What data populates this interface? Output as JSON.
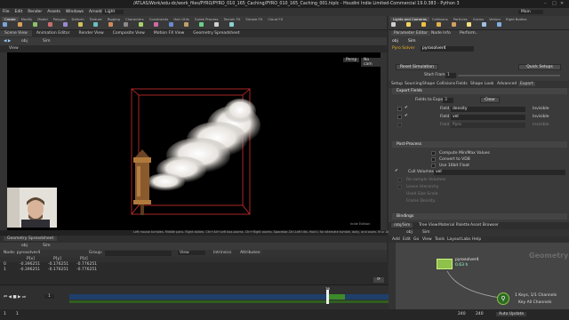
{
  "window": {
    "title": "/ATLAS/Work/edu-dc/work_files/PYRO/PYRO_010_165_Caching/PYRO_010_165_Caching_001.hiplc - Houdini Indie Limited-Commercial 19.0.383 - Python 3"
  },
  "menubar": {
    "items": [
      "File",
      "Edit",
      "Render",
      "Assets",
      "Windows",
      "Arnold",
      "Help"
    ],
    "desktop": "Light",
    "build": "Main"
  },
  "shelf_left": {
    "tabs": [
      "Create",
      "Modify",
      "Model",
      "Polygon",
      "Deform",
      "Texture",
      "Rigging",
      "Characters",
      "Constraints",
      "Hair Utils",
      "Guide Process",
      "Terrain FX",
      "Simple FX",
      "Cloud FX",
      "Volume"
    ]
  },
  "shelf_right": {
    "tabs": [
      "Lights and Cameras",
      "Collisions",
      "Particles",
      "Grains",
      "Vellum",
      "Rigid Bodies",
      "Particle Fluids",
      "Viscous Fluids",
      "Oceans",
      "Pyro FX",
      "FEM"
    ],
    "icons": [
      "Camera",
      "Point Light",
      "Spot Light",
      "Area Light",
      "Volume Light",
      "Distant Light",
      "Environment Light",
      "Sky Light",
      "Portal Light",
      "Ambient Light"
    ]
  },
  "viewport": {
    "tabs": [
      "Scene View",
      "Animation Editor",
      "Render View",
      "Composite View",
      "Motion FX View",
      "Geometry Spreadsheet"
    ],
    "path": "obj",
    "node": "Sim",
    "label": "View",
    "persp": "Persp",
    "cam": "No cam",
    "status": "Left mouse tumbles. Middle pans. Right dollies. Ctrl+Alt+Left box-zooms. Ctrl+Right zooms. Spacebar-Ctrl-Left tilts. Hold L for alternate tumble, dolly, and zoom.    M or Alt+M for First Person Navigation.",
    "overlay": "Indie Edition"
  },
  "spreadsheet": {
    "tabs": [
      "Geometry Spreadsheet"
    ],
    "path": "obj",
    "node": "Sim",
    "node_label": "Node: pyrosolver4",
    "group_label": "Group:",
    "view_label": "View",
    "intrinsics": "Intrinsics",
    "attributes": "Attributes:",
    "headers": [
      "",
      "P[x]",
      "P[y]",
      "P[z]"
    ],
    "rows": [
      [
        "0",
        "-0.396251",
        "-0.176251",
        "-0.776251"
      ],
      [
        "1",
        "-0.396251",
        "-0.176251",
        "-0.776251"
      ]
    ]
  },
  "timeline": {
    "current_frame": "76",
    "start": "1",
    "end": "240",
    "end2": "240",
    "frame_field": "1",
    "marker": "76",
    "auto_update": "Auto Update"
  },
  "parms": {
    "tabs": [
      "Parameter Editor",
      "Node Info",
      "Perform.."
    ],
    "node_type": "Pyro Solver",
    "node_name": "pyrosolver4",
    "path": "obj",
    "node": "Sim",
    "reset_label": "Reset Simulation",
    "quick_setups": "Quick Setups",
    "start_frame_label": "Start Frame",
    "start_frame_value": "1",
    "subtabs": [
      "Setup",
      "Sourcing",
      "Shape",
      "Collisions",
      "Fields",
      "Shape",
      "Look",
      "Advanced",
      "Export"
    ],
    "export_fields": "Export Fields",
    "fields_to_export_label": "Fields to Export",
    "fields_to_export_value": "3",
    "clear": "Clear",
    "field_rows": [
      {
        "label": "Field",
        "value": "density",
        "mode": "Invisible"
      },
      {
        "label": "Field",
        "value": "vel",
        "mode": "Invisible"
      },
      {
        "label": "Field",
        "value": "Pyro",
        "mode": "Invisible"
      }
    ],
    "post_process": "Post-Process",
    "opts": [
      "Compute Min/Max Values",
      "Convert to VDB",
      "Use 16bit Float"
    ],
    "cull_label": "Cull Volumes",
    "cull_value": "vel",
    "dim_opts": [
      "Re-sample Volumes",
      "Leave Hierarchy",
      "Used Size Scale",
      "Frame Density"
    ],
    "bindings": "Bindings"
  },
  "network": {
    "tabs": [
      "/obj/Sim",
      "Tree View",
      "Material Palette",
      "Asset Browser"
    ],
    "path": "obj",
    "node": "Sim",
    "menu": [
      "Add",
      "Edit",
      "Go",
      "View",
      "Tools",
      "Layout",
      "Labs",
      "Help"
    ],
    "context_label": "Geometry",
    "node_label": "pyrosolver4",
    "node_sub": "0.63 h",
    "status1": "1 Keys, 1/1 Channels",
    "status2": "Key All Channels"
  },
  "colors": {
    "accent": "#f0b020",
    "node_green": "#8ec24a",
    "timeline_blue": "#1f3f6b",
    "cache_green": "#3d8a2a"
  }
}
